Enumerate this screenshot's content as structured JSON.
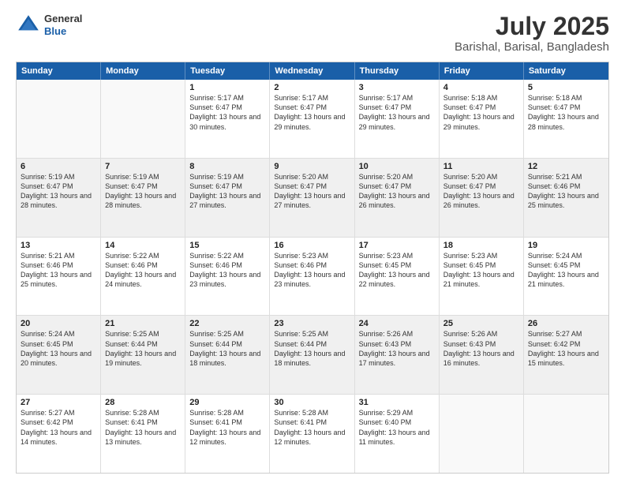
{
  "logo": {
    "general": "General",
    "blue": "Blue"
  },
  "header": {
    "title": "July 2025",
    "subtitle": "Barishal, Barisal, Bangladesh"
  },
  "days": [
    "Sunday",
    "Monday",
    "Tuesday",
    "Wednesday",
    "Thursday",
    "Friday",
    "Saturday"
  ],
  "weeks": [
    [
      {
        "day": "",
        "empty": true
      },
      {
        "day": "",
        "empty": true
      },
      {
        "day": "1",
        "sunrise": "Sunrise: 5:17 AM",
        "sunset": "Sunset: 6:47 PM",
        "daylight": "Daylight: 13 hours and 30 minutes."
      },
      {
        "day": "2",
        "sunrise": "Sunrise: 5:17 AM",
        "sunset": "Sunset: 6:47 PM",
        "daylight": "Daylight: 13 hours and 29 minutes."
      },
      {
        "day": "3",
        "sunrise": "Sunrise: 5:17 AM",
        "sunset": "Sunset: 6:47 PM",
        "daylight": "Daylight: 13 hours and 29 minutes."
      },
      {
        "day": "4",
        "sunrise": "Sunrise: 5:18 AM",
        "sunset": "Sunset: 6:47 PM",
        "daylight": "Daylight: 13 hours and 29 minutes."
      },
      {
        "day": "5",
        "sunrise": "Sunrise: 5:18 AM",
        "sunset": "Sunset: 6:47 PM",
        "daylight": "Daylight: 13 hours and 28 minutes."
      }
    ],
    [
      {
        "day": "6",
        "sunrise": "Sunrise: 5:19 AM",
        "sunset": "Sunset: 6:47 PM",
        "daylight": "Daylight: 13 hours and 28 minutes."
      },
      {
        "day": "7",
        "sunrise": "Sunrise: 5:19 AM",
        "sunset": "Sunset: 6:47 PM",
        "daylight": "Daylight: 13 hours and 28 minutes."
      },
      {
        "day": "8",
        "sunrise": "Sunrise: 5:19 AM",
        "sunset": "Sunset: 6:47 PM",
        "daylight": "Daylight: 13 hours and 27 minutes."
      },
      {
        "day": "9",
        "sunrise": "Sunrise: 5:20 AM",
        "sunset": "Sunset: 6:47 PM",
        "daylight": "Daylight: 13 hours and 27 minutes."
      },
      {
        "day": "10",
        "sunrise": "Sunrise: 5:20 AM",
        "sunset": "Sunset: 6:47 PM",
        "daylight": "Daylight: 13 hours and 26 minutes."
      },
      {
        "day": "11",
        "sunrise": "Sunrise: 5:20 AM",
        "sunset": "Sunset: 6:47 PM",
        "daylight": "Daylight: 13 hours and 26 minutes."
      },
      {
        "day": "12",
        "sunrise": "Sunrise: 5:21 AM",
        "sunset": "Sunset: 6:46 PM",
        "daylight": "Daylight: 13 hours and 25 minutes."
      }
    ],
    [
      {
        "day": "13",
        "sunrise": "Sunrise: 5:21 AM",
        "sunset": "Sunset: 6:46 PM",
        "daylight": "Daylight: 13 hours and 25 minutes."
      },
      {
        "day": "14",
        "sunrise": "Sunrise: 5:22 AM",
        "sunset": "Sunset: 6:46 PM",
        "daylight": "Daylight: 13 hours and 24 minutes."
      },
      {
        "day": "15",
        "sunrise": "Sunrise: 5:22 AM",
        "sunset": "Sunset: 6:46 PM",
        "daylight": "Daylight: 13 hours and 23 minutes."
      },
      {
        "day": "16",
        "sunrise": "Sunrise: 5:23 AM",
        "sunset": "Sunset: 6:46 PM",
        "daylight": "Daylight: 13 hours and 23 minutes."
      },
      {
        "day": "17",
        "sunrise": "Sunrise: 5:23 AM",
        "sunset": "Sunset: 6:45 PM",
        "daylight": "Daylight: 13 hours and 22 minutes."
      },
      {
        "day": "18",
        "sunrise": "Sunrise: 5:23 AM",
        "sunset": "Sunset: 6:45 PM",
        "daylight": "Daylight: 13 hours and 21 minutes."
      },
      {
        "day": "19",
        "sunrise": "Sunrise: 5:24 AM",
        "sunset": "Sunset: 6:45 PM",
        "daylight": "Daylight: 13 hours and 21 minutes."
      }
    ],
    [
      {
        "day": "20",
        "sunrise": "Sunrise: 5:24 AM",
        "sunset": "Sunset: 6:45 PM",
        "daylight": "Daylight: 13 hours and 20 minutes."
      },
      {
        "day": "21",
        "sunrise": "Sunrise: 5:25 AM",
        "sunset": "Sunset: 6:44 PM",
        "daylight": "Daylight: 13 hours and 19 minutes."
      },
      {
        "day": "22",
        "sunrise": "Sunrise: 5:25 AM",
        "sunset": "Sunset: 6:44 PM",
        "daylight": "Daylight: 13 hours and 18 minutes."
      },
      {
        "day": "23",
        "sunrise": "Sunrise: 5:25 AM",
        "sunset": "Sunset: 6:44 PM",
        "daylight": "Daylight: 13 hours and 18 minutes."
      },
      {
        "day": "24",
        "sunrise": "Sunrise: 5:26 AM",
        "sunset": "Sunset: 6:43 PM",
        "daylight": "Daylight: 13 hours and 17 minutes."
      },
      {
        "day": "25",
        "sunrise": "Sunrise: 5:26 AM",
        "sunset": "Sunset: 6:43 PM",
        "daylight": "Daylight: 13 hours and 16 minutes."
      },
      {
        "day": "26",
        "sunrise": "Sunrise: 5:27 AM",
        "sunset": "Sunset: 6:42 PM",
        "daylight": "Daylight: 13 hours and 15 minutes."
      }
    ],
    [
      {
        "day": "27",
        "sunrise": "Sunrise: 5:27 AM",
        "sunset": "Sunset: 6:42 PM",
        "daylight": "Daylight: 13 hours and 14 minutes."
      },
      {
        "day": "28",
        "sunrise": "Sunrise: 5:28 AM",
        "sunset": "Sunset: 6:41 PM",
        "daylight": "Daylight: 13 hours and 13 minutes."
      },
      {
        "day": "29",
        "sunrise": "Sunrise: 5:28 AM",
        "sunset": "Sunset: 6:41 PM",
        "daylight": "Daylight: 13 hours and 12 minutes."
      },
      {
        "day": "30",
        "sunrise": "Sunrise: 5:28 AM",
        "sunset": "Sunset: 6:41 PM",
        "daylight": "Daylight: 13 hours and 12 minutes."
      },
      {
        "day": "31",
        "sunrise": "Sunrise: 5:29 AM",
        "sunset": "Sunset: 6:40 PM",
        "daylight": "Daylight: 13 hours and 11 minutes."
      },
      {
        "day": "",
        "empty": true
      },
      {
        "day": "",
        "empty": true
      }
    ]
  ]
}
